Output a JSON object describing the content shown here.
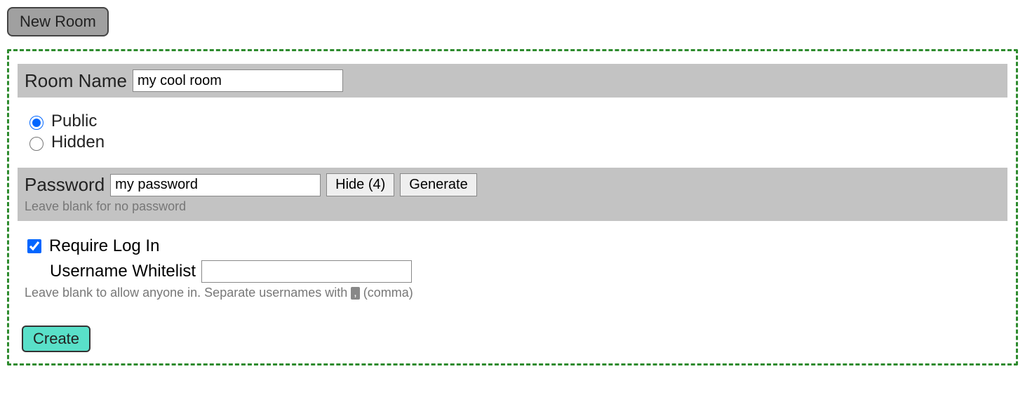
{
  "header": {
    "new_room_label": "New Room"
  },
  "room_name": {
    "label": "Room Name",
    "value": "my cool room"
  },
  "visibility": {
    "public_label": "Public",
    "hidden_label": "Hidden",
    "selected": "public"
  },
  "password": {
    "label": "Password",
    "value": "my password",
    "hide_label": "Hide (4)",
    "generate_label": "Generate",
    "hint": "Leave blank for no password"
  },
  "login": {
    "require_label": "Require Log In",
    "require_checked": true,
    "whitelist_label": "Username Whitelist",
    "whitelist_value": "",
    "hint_prefix": "Leave blank to allow anyone in. Separate usernames with ",
    "hint_comma": ",",
    "hint_suffix": " (comma)"
  },
  "actions": {
    "create_label": "Create"
  }
}
